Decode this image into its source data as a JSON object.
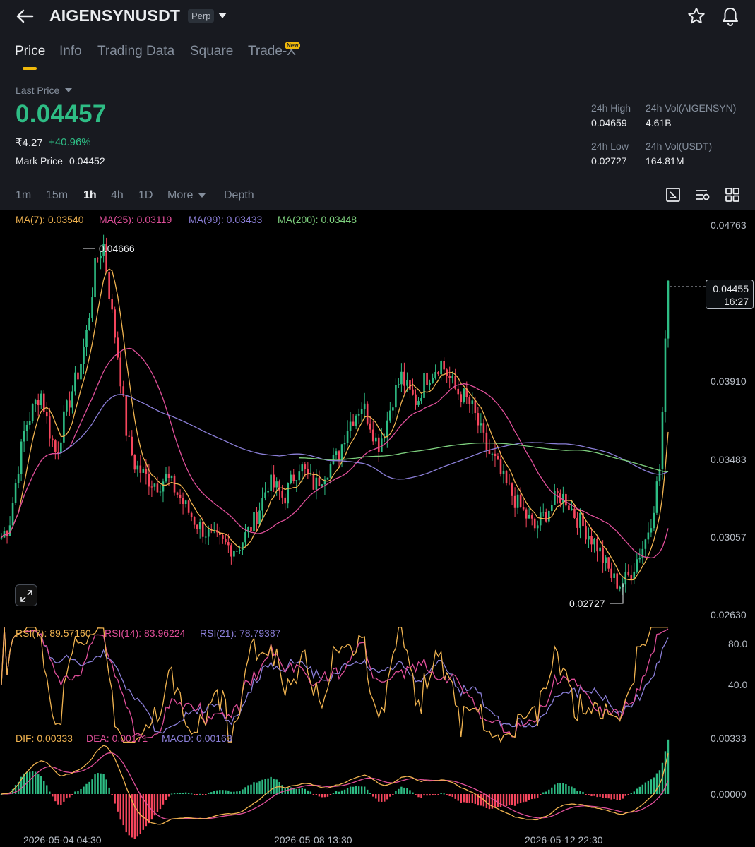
{
  "header": {
    "symbol": "AIGENSYNUSDT",
    "contract_badge": "Perp",
    "icons": [
      "back-arrow-icon",
      "caret-down-icon",
      "star-icon",
      "bell-icon"
    ]
  },
  "tabs": [
    {
      "label": "Price",
      "active": true
    },
    {
      "label": "Info",
      "active": false
    },
    {
      "label": "Trading Data",
      "active": false
    },
    {
      "label": "Square",
      "active": false
    },
    {
      "label": "Trade-X",
      "active": false,
      "badge": "New"
    }
  ],
  "ticker": {
    "last_price_label": "Last Price",
    "last_price": "0.04457",
    "inr_value": "₹4.27",
    "change_pct": "+40.96%",
    "mark_price_label": "Mark Price",
    "mark_price": "0.04452"
  },
  "stats": {
    "high_label": "24h High",
    "high": "0.04659",
    "vol_base_label": "24h Vol(AIGENSYN)",
    "vol_base": "4.61B",
    "low_label": "24h Low",
    "low": "0.02727",
    "vol_quote_label": "24h Vol(USDT)",
    "vol_quote": "164.81M"
  },
  "intervals": [
    {
      "label": "1m",
      "active": false
    },
    {
      "label": "15m",
      "active": false
    },
    {
      "label": "1h",
      "active": true
    },
    {
      "label": "4h",
      "active": false
    },
    {
      "label": "1D",
      "active": false
    },
    {
      "label": "More",
      "active": false
    },
    {
      "label": "Depth",
      "active": false
    }
  ],
  "toolbar_icons": [
    "indicator-toggle-icon",
    "chart-settings-icon",
    "layout-grid-icon"
  ],
  "colors": {
    "up": "#2ebd85",
    "down": "#f6465d",
    "accent": "#f0b90b",
    "ma7": "#f0b350",
    "ma25": "#e04f9a",
    "ma99": "#8b7fd8",
    "ma200": "#7ed07e",
    "rsi7": "#f0b350",
    "rsi14": "#e04f9a",
    "rsi21": "#8b7fd8",
    "dif": "#f0b350",
    "dea": "#e04f9a",
    "macd": "#8b7fd8"
  },
  "chart_data": [
    {
      "type": "candlestick",
      "indicator": "MA",
      "legend": [
        {
          "label": "MA(7): 0.03540",
          "color": "#f0b350"
        },
        {
          "label": "MA(25): 0.03119",
          "color": "#e04f9a"
        },
        {
          "label": "MA(99): 0.03433",
          "color": "#8b7fd8"
        },
        {
          "label": "MA(200): 0.03448",
          "color": "#7ed07e"
        }
      ],
      "y_ticks": [
        "0.04763",
        "0.03910",
        "0.03483",
        "0.03057",
        "0.02630"
      ],
      "ylim": [
        0.0263,
        0.04763
      ],
      "max_label": "0.04666",
      "min_label": "0.02727",
      "current_price": "0.04455",
      "countdown": "16:27",
      "x_ticks": [
        "2026-05-04 04:30",
        "2026-05-08 13:30",
        "2026-05-12 22:30"
      ],
      "price_path": [
        0.0305,
        0.0312,
        0.034,
        0.0365,
        0.0375,
        0.0385,
        0.0365,
        0.035,
        0.037,
        0.0385,
        0.0398,
        0.042,
        0.0455,
        0.0466,
        0.043,
        0.04,
        0.036,
        0.0345,
        0.034,
        0.0336,
        0.0334,
        0.0338,
        0.0332,
        0.0325,
        0.0318,
        0.0312,
        0.0308,
        0.0304,
        0.0302,
        0.03,
        0.0299,
        0.0305,
        0.0312,
        0.0322,
        0.0335,
        0.0332,
        0.0326,
        0.0336,
        0.0345,
        0.0338,
        0.0333,
        0.034,
        0.0345,
        0.035,
        0.0365,
        0.0372,
        0.0378,
        0.0368,
        0.0355,
        0.0366,
        0.0383,
        0.0393,
        0.0384,
        0.0379,
        0.0392,
        0.0396,
        0.0401,
        0.0393,
        0.0385,
        0.0382,
        0.0376,
        0.0364,
        0.0352,
        0.0346,
        0.0336,
        0.0329,
        0.0322,
        0.0316,
        0.031,
        0.0316,
        0.0322,
        0.0328,
        0.0326,
        0.0318,
        0.0312,
        0.0306,
        0.03,
        0.029,
        0.0282,
        0.0279,
        0.0284,
        0.0293,
        0.0302,
        0.0318,
        0.0345,
        0.0446
      ]
    },
    {
      "type": "line",
      "indicator": "RSI",
      "legend": [
        {
          "label": "RSI(7): 89.57160",
          "color": "#f0b350"
        },
        {
          "label": "RSI(14): 83.96224",
          "color": "#e04f9a"
        },
        {
          "label": "RSI(21): 78.79387",
          "color": "#8b7fd8"
        }
      ],
      "y_ticks": [
        "80.0",
        "40.0"
      ]
    },
    {
      "type": "line",
      "indicator": "MACD",
      "legend": [
        {
          "label": "DIF: 0.00333",
          "color": "#f0b350"
        },
        {
          "label": "DEA: 0.00171",
          "color": "#e04f9a"
        },
        {
          "label": "MACD: 0.00163",
          "color": "#8b7fd8"
        }
      ],
      "y_ticks": [
        "0.00333",
        "0.00000"
      ]
    }
  ]
}
